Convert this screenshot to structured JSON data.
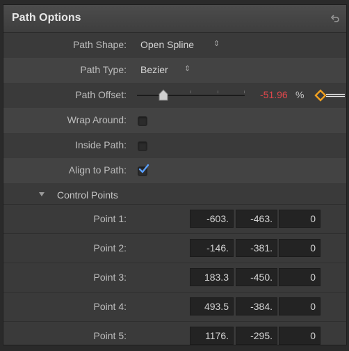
{
  "header": {
    "title": "Path Options"
  },
  "path_shape": {
    "label": "Path Shape:",
    "value": "Open Spline"
  },
  "path_type": {
    "label": "Path Type:",
    "value": "Bezier"
  },
  "path_offset": {
    "label": "Path Offset:",
    "value": "-51.96",
    "unit": "%"
  },
  "wrap_around": {
    "label": "Wrap Around:",
    "checked": false
  },
  "inside_path": {
    "label": "Inside Path:",
    "checked": false
  },
  "align_to_path": {
    "label": "Align to Path:",
    "checked": true
  },
  "control_points": {
    "label": "Control Points",
    "points": [
      {
        "label": "Point 1:",
        "x": "-603.",
        "y": "-463.",
        "z": "0"
      },
      {
        "label": "Point 2:",
        "x": "-146.",
        "y": "-381.",
        "z": "0"
      },
      {
        "label": "Point 3:",
        "x": "183.3",
        "y": "-450.",
        "z": "0"
      },
      {
        "label": "Point 4:",
        "x": "493.5",
        "y": "-384.",
        "z": "0"
      },
      {
        "label": "Point 5:",
        "x": "1176.",
        "y": "-295.",
        "z": "0"
      }
    ]
  },
  "colors": {
    "offset_value": "#e0474c",
    "keyframe": "#f0a020",
    "accent": "#5aa0ff"
  }
}
